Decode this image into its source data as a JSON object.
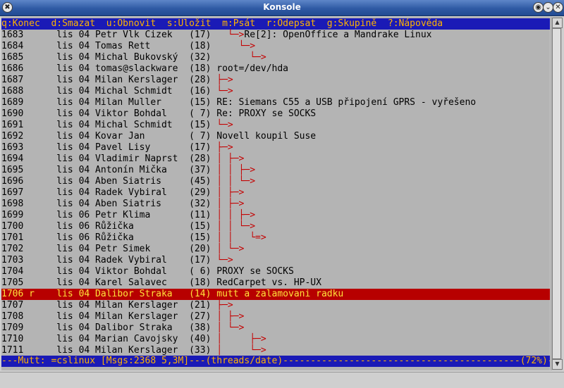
{
  "window": {
    "title": "Konsole"
  },
  "titlebar_buttons": {
    "menu": "✖",
    "sticky": "◉",
    "minimize": "⌄",
    "close": "✕"
  },
  "help_bar": "q:Konec  d:Smazat  u:Obnovit  s:Uložit  m:Psát  r:Odepsat  g:Skupině  ?:Nápověda",
  "messages": [
    {
      "num": "1683",
      "flag": " ",
      "date": "lis 04",
      "from": "Petr Vlk Cizek",
      "size": "17",
      "tree": "  └─>",
      "subject": "Re[2]: OpenOffice a Mandrake Linux"
    },
    {
      "num": "1684",
      "flag": " ",
      "date": "lis 04",
      "from": "Tomas Rett",
      "size": "18",
      "tree": "    └─>",
      "subject": ""
    },
    {
      "num": "1685",
      "flag": " ",
      "date": "lis 04",
      "from": "Michal Bukovský",
      "size": "32",
      "tree": "      └─>",
      "subject": ""
    },
    {
      "num": "1686",
      "flag": " ",
      "date": "lis 04",
      "from": "tomas@slackware",
      "size": "18",
      "tree": "",
      "subject": "root=/dev/hda"
    },
    {
      "num": "1687",
      "flag": " ",
      "date": "lis 04",
      "from": "Milan Kerslager",
      "size": "28",
      "tree": "├─>",
      "subject": ""
    },
    {
      "num": "1688",
      "flag": " ",
      "date": "lis 04",
      "from": "Michal Schmidt",
      "size": "16",
      "tree": "└─>",
      "subject": ""
    },
    {
      "num": "1689",
      "flag": " ",
      "date": "lis 04",
      "from": "Milan Muller",
      "size": "15",
      "tree": "",
      "subject": "RE: Siemans C55 a USB připojení GPRS - vyřešeno"
    },
    {
      "num": "1690",
      "flag": " ",
      "date": "lis 04",
      "from": "Viktor Bohdal",
      "size": " 7",
      "tree": "",
      "subject": "Re: PROXY se SOCKS"
    },
    {
      "num": "1691",
      "flag": " ",
      "date": "lis 04",
      "from": "Michal Schmidt",
      "size": "15",
      "tree": "└─>",
      "subject": ""
    },
    {
      "num": "1692",
      "flag": " ",
      "date": "lis 04",
      "from": "Kovar Jan",
      "size": " 7",
      "tree": "",
      "subject": "Novell koupil Suse"
    },
    {
      "num": "1693",
      "flag": " ",
      "date": "lis 04",
      "from": "Pavel Lisy",
      "size": "17",
      "tree": "├─>",
      "subject": ""
    },
    {
      "num": "1694",
      "flag": " ",
      "date": "lis 04",
      "from": "Vladimir Naprst",
      "size": "28",
      "tree": "│ ├─>",
      "subject": ""
    },
    {
      "num": "1695",
      "flag": " ",
      "date": "lis 04",
      "from": "Antonín Mička",
      "size": "37",
      "tree": "│ │ ├─>",
      "subject": ""
    },
    {
      "num": "1696",
      "flag": " ",
      "date": "lis 04",
      "from": "Aben Siatris",
      "size": "45",
      "tree": "│ │ └─>",
      "subject": ""
    },
    {
      "num": "1697",
      "flag": " ",
      "date": "lis 04",
      "from": "Radek Vybiral",
      "size": "29",
      "tree": "│ ├─>",
      "subject": ""
    },
    {
      "num": "1698",
      "flag": " ",
      "date": "lis 04",
      "from": "Aben Siatris",
      "size": "32",
      "tree": "│ ├─>",
      "subject": ""
    },
    {
      "num": "1699",
      "flag": " ",
      "date": "lis 06",
      "from": "Petr Klima",
      "size": "11",
      "tree": "│ │ ├─>",
      "subject": ""
    },
    {
      "num": "1700",
      "flag": " ",
      "date": "lis 06",
      "from": "Růžička",
      "size": "15",
      "tree": "│ │ └─>",
      "subject": ""
    },
    {
      "num": "1701",
      "flag": " ",
      "date": "lis 06",
      "from": "Růžička",
      "size": "15",
      "tree": "│ │   └=>",
      "subject": ""
    },
    {
      "num": "1702",
      "flag": " ",
      "date": "lis 04",
      "from": "Petr Simek",
      "size": "20",
      "tree": "│ └─>",
      "subject": ""
    },
    {
      "num": "1703",
      "flag": " ",
      "date": "lis 04",
      "from": "Radek Vybiral",
      "size": "17",
      "tree": "└─>",
      "subject": ""
    },
    {
      "num": "1704",
      "flag": " ",
      "date": "lis 04",
      "from": "Viktor Bohdal",
      "size": " 6",
      "tree": "",
      "subject": "PROXY se SOCKS"
    },
    {
      "num": "1705",
      "flag": " ",
      "date": "lis 04",
      "from": "Karel Salavec",
      "size": "18",
      "tree": "",
      "subject": "RedCarpet vs. HP-UX"
    },
    {
      "num": "1706",
      "flag": "r",
      "date": "lis 04",
      "from": "Dalibor Straka",
      "size": "14",
      "tree": "",
      "subject": "mutt a zalamovani radku",
      "selected": true
    },
    {
      "num": "1707",
      "flag": " ",
      "date": "lis 04",
      "from": "Milan Kerslager",
      "size": "21",
      "tree": "├─>",
      "subject": ""
    },
    {
      "num": "1708",
      "flag": " ",
      "date": "lis 04",
      "from": "Milan Kerslager",
      "size": "27",
      "tree": "│ ├─>",
      "subject": ""
    },
    {
      "num": "1709",
      "flag": " ",
      "date": "lis 04",
      "from": "Dalibor Straka",
      "size": "38",
      "tree": "│ └─>",
      "subject": ""
    },
    {
      "num": "1710",
      "flag": " ",
      "date": "lis 04",
      "from": "Marian Cavojsky",
      "size": "40",
      "tree": "│     ├─>",
      "subject": ""
    },
    {
      "num": "1711",
      "flag": " ",
      "date": "lis 04",
      "from": "Milan Kerslager",
      "size": "33",
      "tree": "│     └─>",
      "subject": ""
    }
  ],
  "status_bar": "---Mutt: =cslinux [Msgs:2368 5,3M]---(threads/date)-------------------------------------------(72%)---",
  "scrollbar": {
    "up": "▲",
    "down": "▼"
  }
}
